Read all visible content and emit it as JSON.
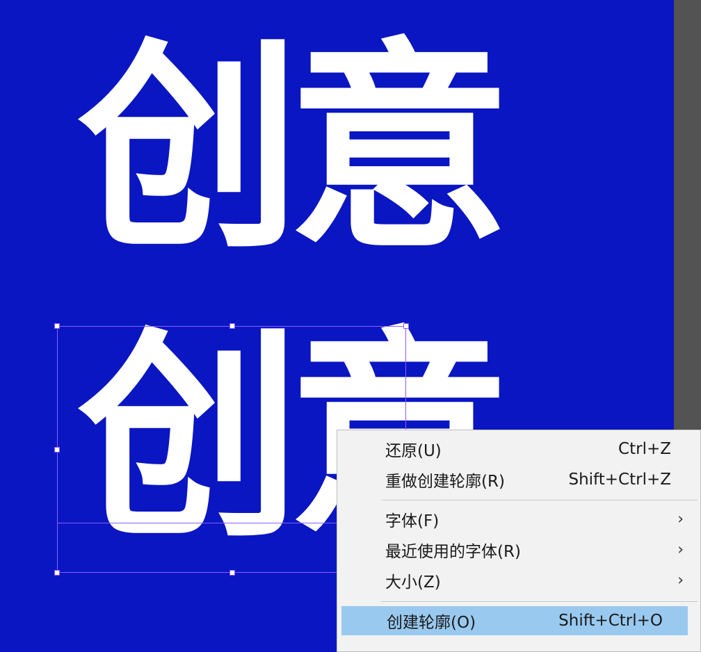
{
  "canvas": {
    "text_top": "创意",
    "text_bottom": "创意",
    "background_color": "#0a16c2",
    "selection_color": "#8a5cff"
  },
  "context_menu": {
    "items": [
      {
        "label": "还原(U)",
        "shortcut": "Ctrl+Z",
        "submenu": false
      },
      {
        "label": "重做创建轮廓(R)",
        "shortcut": "Shift+Ctrl+Z",
        "submenu": false
      },
      {
        "label": "字体(F)",
        "shortcut": "",
        "submenu": true
      },
      {
        "label": "最近使用的字体(R)",
        "shortcut": "",
        "submenu": true
      },
      {
        "label": "大小(Z)",
        "shortcut": "",
        "submenu": true
      },
      {
        "label": "创建轮廓(O)",
        "shortcut": "Shift+Ctrl+O",
        "submenu": false,
        "highlighted": true
      }
    ],
    "submenu_arrow": "›",
    "highlight_color": "#99c9ef"
  }
}
